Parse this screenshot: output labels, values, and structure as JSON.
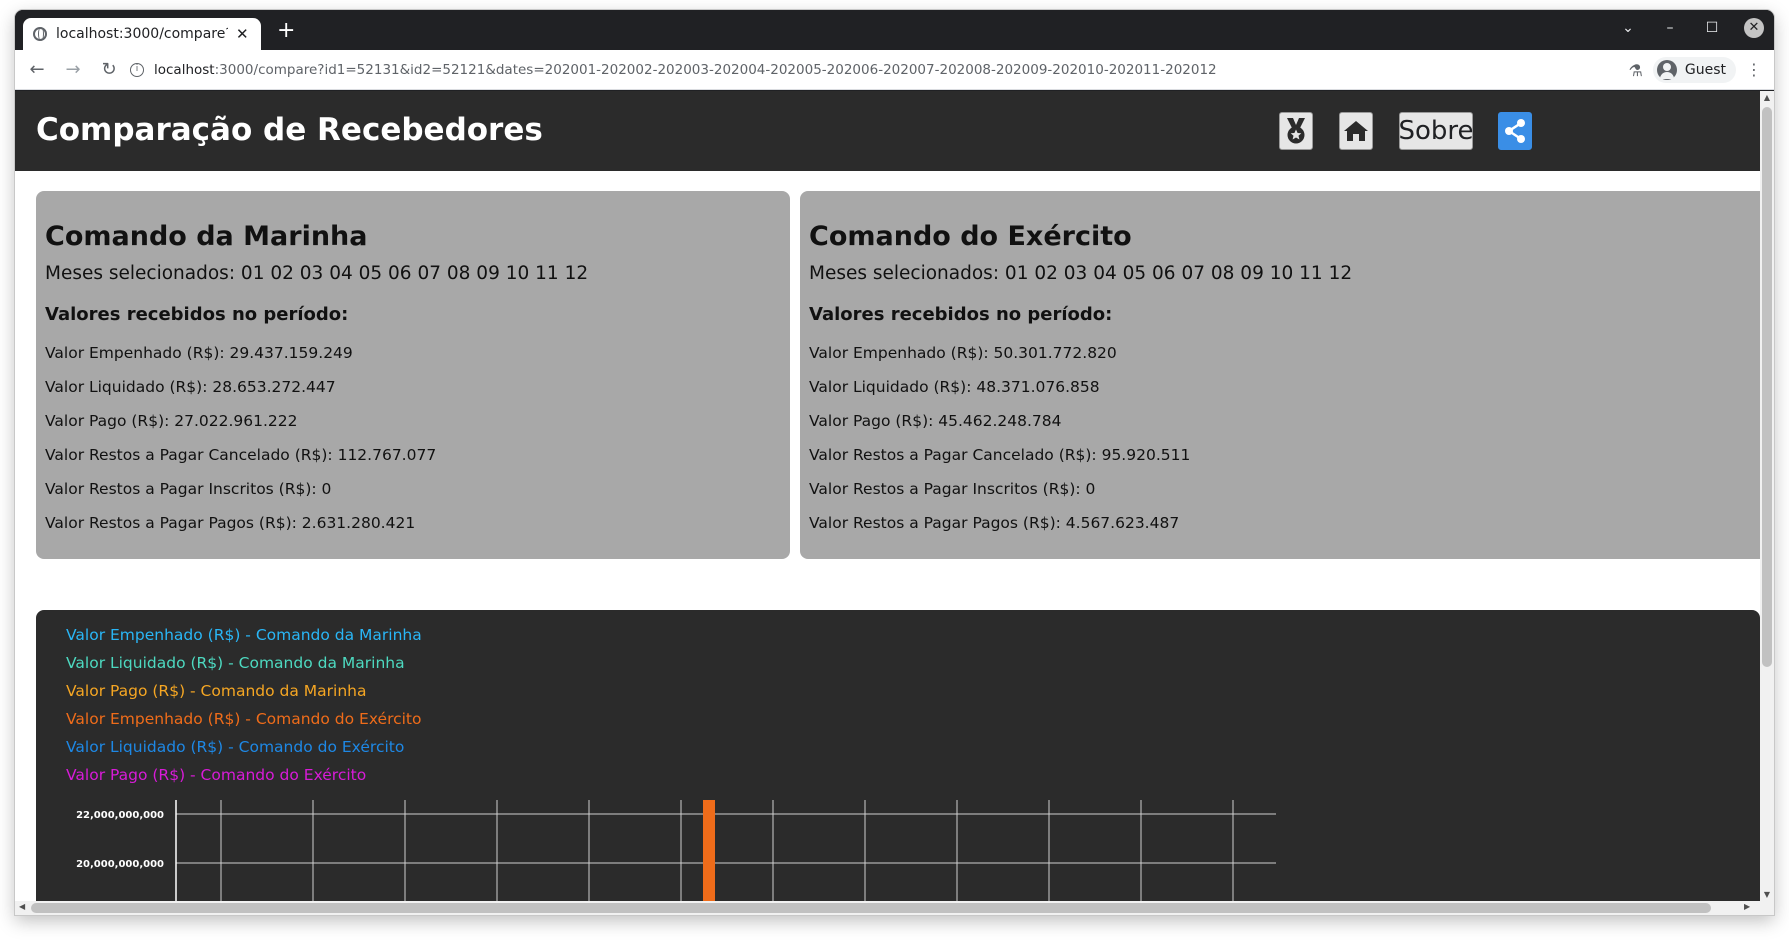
{
  "browser": {
    "tab_title": "localhost:3000/compare?i",
    "tab_close": "✕",
    "new_tab": "+",
    "url_host": "localhost",
    "url_rest": ":3000/compare?id1=52131&id2=52121&dates=202001-202002-202003-202004-202005-202006-202007-202008-202009-202010-202011-202012",
    "profile_name": "Guest"
  },
  "app": {
    "title": "Comparação de Recebedores",
    "about_label": "Sobre"
  },
  "cards": [
    {
      "name": "Comando da Marinha",
      "months": "Meses selecionados: 01 02 03 04 05 06 07 08 09 10 11 12",
      "subhead": "Valores recebidos no período:",
      "values": [
        "Valor Empenhado (R$): 29.437.159.249",
        "Valor Liquidado (R$): 28.653.272.447",
        "Valor Pago (R$): 27.022.961.222",
        "Valor Restos a Pagar Cancelado (R$): 112.767.077",
        "Valor Restos a Pagar Inscritos (R$): 0",
        "Valor Restos a Pagar Pagos (R$): 2.631.280.421"
      ]
    },
    {
      "name": "Comando do Exército",
      "months": "Meses selecionados: 01 02 03 04 05 06 07 08 09 10 11 12",
      "subhead": "Valores recebidos no período:",
      "values": [
        "Valor Empenhado (R$): 50.301.772.820",
        "Valor Liquidado (R$): 48.371.076.858",
        "Valor Pago (R$): 45.462.248.784",
        "Valor Restos a Pagar Cancelado (R$): 95.920.511",
        "Valor Restos a Pagar Inscritos (R$): 0",
        "Valor Restos a Pagar Pagos (R$): 4.567.623.487"
      ]
    }
  ],
  "chart": {
    "legend": [
      {
        "label": "Valor Empenhado (R$) - Comando da Marinha",
        "color": "#29b6f6"
      },
      {
        "label": "Valor Liquidado (R$) - Comando da Marinha",
        "color": "#4dd9c0"
      },
      {
        "label": "Valor Pago (R$) - Comando da Marinha",
        "color": "#f5a623"
      },
      {
        "label": "Valor Empenhado (R$) - Comando do Exército",
        "color": "#ef6c1a"
      },
      {
        "label": "Valor Liquidado (R$) - Comando do Exército",
        "color": "#1e88e5"
      },
      {
        "label": "Valor Pago (R$) - Comando do Exército",
        "color": "#d81bd8"
      }
    ],
    "y_ticks": [
      "22,000,000,000",
      "20,000,000,000"
    ],
    "visible_bar_color": "#ef6c1a"
  },
  "colors": {
    "header_bg": "#2b2b2b",
    "card_bg": "#a8a8a8",
    "share_blue": "#3a8ee6"
  }
}
